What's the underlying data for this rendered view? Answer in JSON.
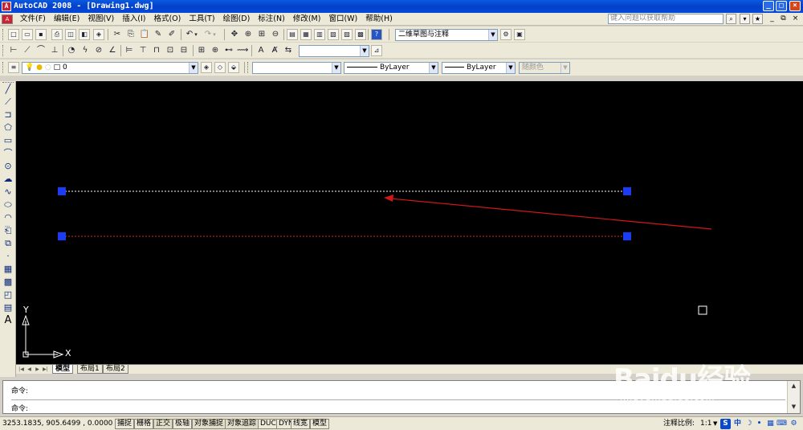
{
  "window": {
    "title": "AutoCAD 2008 - [Drawing1.dwg]",
    "app_icon": "A"
  },
  "menu": {
    "items": [
      "文件(F)",
      "编辑(E)",
      "视图(V)",
      "插入(I)",
      "格式(O)",
      "工具(T)",
      "绘图(D)",
      "标注(N)",
      "修改(M)",
      "窗口(W)",
      "帮助(H)"
    ],
    "help_search_placeholder": "键入问题以获取帮助"
  },
  "toolbar": {
    "workspace": "二维草图与注释",
    "text_style": "",
    "layer": "0",
    "color": "",
    "linetype": "ByLayer",
    "lineweight": "ByLayer",
    "plot_style": "随颜色"
  },
  "tabs": {
    "model": "模型",
    "layout1": "布局1",
    "layout2": "布局2"
  },
  "command": {
    "line1": "命令:",
    "line2": "命令:"
  },
  "status": {
    "coords": "3253.1835, 905.6499 , 0.0000",
    "toggles": [
      "捕捉",
      "栅格",
      "正交",
      "极轴",
      "对象捕捉",
      "对象追踪",
      "DUCS",
      "DYN",
      "线宽",
      "模型"
    ],
    "annotation_scale_label": "注释比例:",
    "annotation_scale_value": "1:1"
  },
  "ucs": {
    "x_label": "X",
    "y_label": "Y"
  },
  "watermark": {
    "brand": "Baidu经验",
    "url": "jingyan.baidu.com"
  },
  "colors": {
    "canvas": "#000000",
    "grip": "#1a3cf5",
    "line_white": "#ffffff",
    "line_red": "#e02020",
    "arrow": "#d01818"
  }
}
